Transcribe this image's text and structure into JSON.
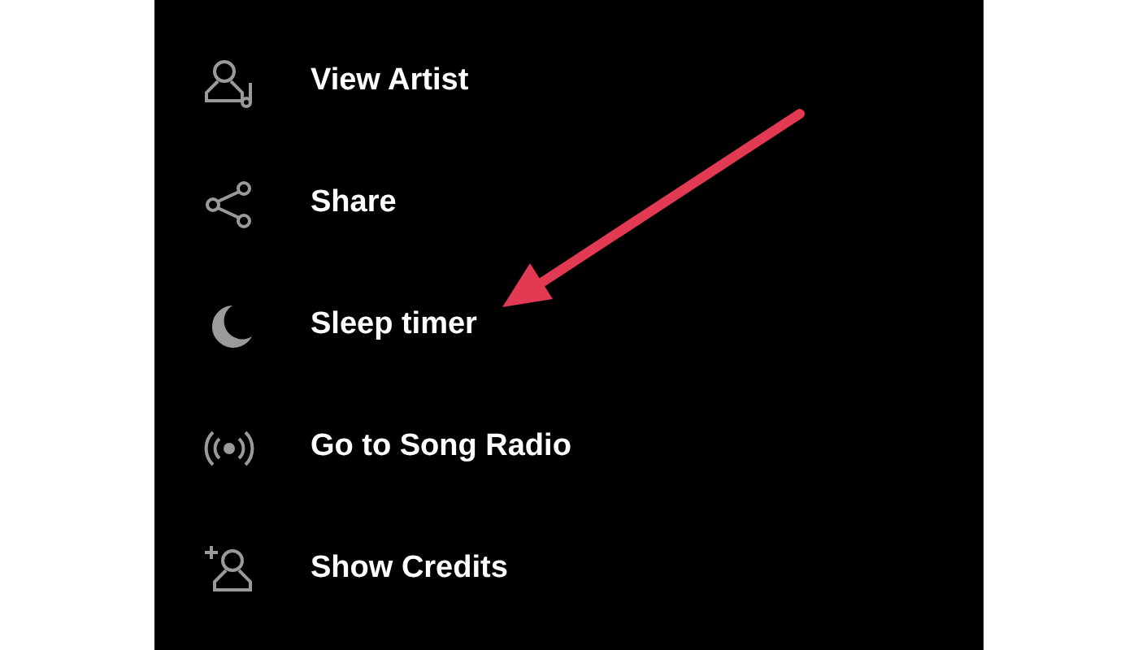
{
  "menu": [
    {
      "kind": "artist",
      "label": "View Artist"
    },
    {
      "kind": "share",
      "label": "Share"
    },
    {
      "kind": "moon",
      "label": "Sleep timer"
    },
    {
      "kind": "radio",
      "label": "Go to Song Radio"
    },
    {
      "kind": "credits",
      "label": "Show Credits"
    }
  ]
}
